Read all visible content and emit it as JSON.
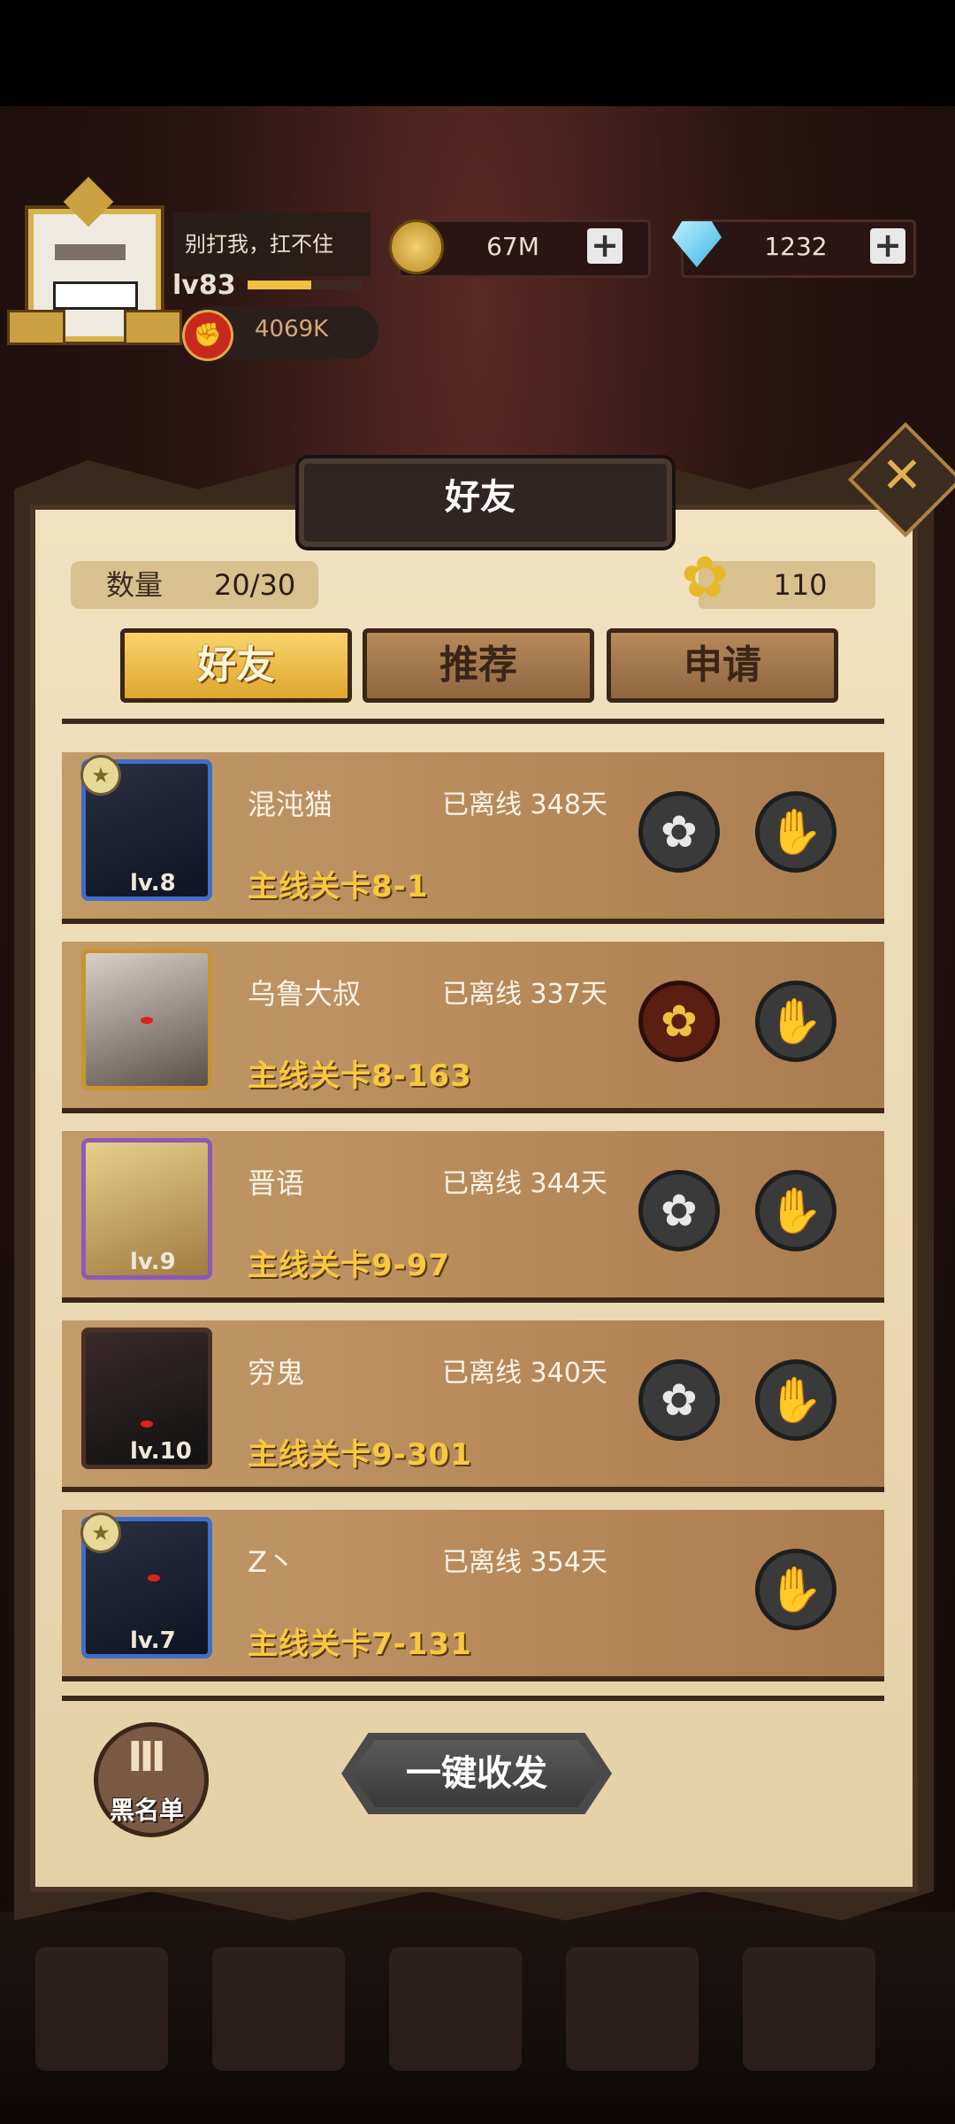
{
  "hud": {
    "player_name": "别打我，扛不住",
    "level": "lv83",
    "level_progress": 0.55,
    "power": "4069K",
    "gold": "67M",
    "diamonds": "1232",
    "plus": "+"
  },
  "panel": {
    "title": "好友",
    "close": "✕",
    "count_label": "数量",
    "count_value": "20/30",
    "flower_count": "110",
    "tabs": [
      {
        "label": "好友",
        "active": true
      },
      {
        "label": "推荐",
        "active": false
      },
      {
        "label": "申请",
        "active": false
      }
    ]
  },
  "friends": [
    {
      "name": "混沌猫",
      "offline": "已离线 348天",
      "stage": "主线关卡8-1",
      "portrait_level": "lv.8",
      "gift_sent": false,
      "can_send": true
    },
    {
      "name": "乌鲁大叔",
      "offline": "已离线 337天",
      "stage": "主线关卡8-163",
      "portrait_level": "",
      "gift_sent": true,
      "can_send": true
    },
    {
      "name": "晋语",
      "offline": "已离线 344天",
      "stage": "主线关卡9-97",
      "portrait_level": "lv.9",
      "gift_sent": false,
      "can_send": true
    },
    {
      "name": "穷鬼",
      "offline": "已离线 340天",
      "stage": "主线关卡9-301",
      "portrait_level": "lv.10",
      "gift_sent": false,
      "can_send": true
    },
    {
      "name": "Z丶",
      "offline": "已离线 354天",
      "stage": "主线关卡7-131",
      "portrait_level": "lv.7",
      "gift_sent": false,
      "can_send": false
    }
  ],
  "footer": {
    "blacklist_icon": "Ⅲ",
    "blacklist_label": "黑名单",
    "one_key_label": "一键收发"
  },
  "icons": {
    "flower": "✿",
    "hand": "✋",
    "fist": "✊"
  }
}
